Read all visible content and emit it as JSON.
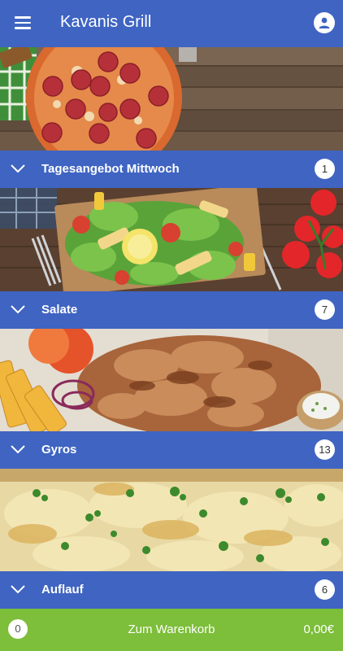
{
  "appbar": {
    "title": "Kavanis Grill",
    "menu_icon": "hamburger-menu-icon",
    "account_icon": "user-account-icon"
  },
  "categories": [
    {
      "label": "Tagesangebot Mittwoch",
      "count": "1",
      "image": "pizza"
    },
    {
      "label": "Salate",
      "count": "7",
      "image": "salad"
    },
    {
      "label": "Gyros",
      "count": "13",
      "image": "gyros"
    },
    {
      "label": "Auflauf",
      "count": "6",
      "image": "casserole"
    }
  ],
  "cart": {
    "count": "0",
    "label": "Zum Warenkorb",
    "total": "0,00€"
  },
  "colors": {
    "primary": "#3f64c2",
    "cart": "#7dbe3a"
  }
}
